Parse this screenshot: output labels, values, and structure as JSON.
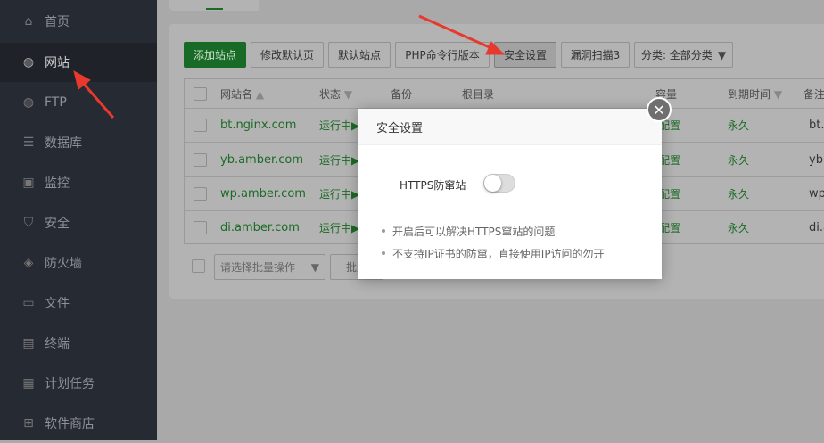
{
  "sidebar": {
    "items": [
      {
        "label": "首页",
        "icon": "home-icon"
      },
      {
        "label": "网站",
        "icon": "globe-icon",
        "active": true
      },
      {
        "label": "FTP",
        "icon": "ftp-icon"
      },
      {
        "label": "数据库",
        "icon": "database-icon"
      },
      {
        "label": "监控",
        "icon": "monitor-icon"
      },
      {
        "label": "安全",
        "icon": "shield-icon"
      },
      {
        "label": "防火墙",
        "icon": "firewall-icon"
      },
      {
        "label": "文件",
        "icon": "folder-icon"
      },
      {
        "label": "终端",
        "icon": "terminal-icon"
      },
      {
        "label": "计划任务",
        "icon": "calendar-icon"
      },
      {
        "label": "软件商店",
        "icon": "apps-icon"
      }
    ]
  },
  "toolbar": {
    "add_site": "添加站点",
    "edit_default_page": "修改默认页",
    "default_site": "默认站点",
    "php_cli": "PHP命令行版本",
    "security": "安全设置",
    "vuln_scan": "漏洞扫描3",
    "category": "分类: 全部分类"
  },
  "table": {
    "headers": {
      "name": "网站名",
      "status": "状态",
      "backup": "备份",
      "root": "根目录",
      "quota": "容量",
      "expire": "到期时间",
      "note": "备注"
    },
    "rows": [
      {
        "name": "bt.nginx.com",
        "status": "运行中",
        "quota": "未配置",
        "expire": "永久",
        "note": "bt.n"
      },
      {
        "name": "yb.amber.com",
        "status": "运行中",
        "quota": "未配置",
        "expire": "永久",
        "note": "yb.a"
      },
      {
        "name": "wp.amber.com",
        "status": "运行中",
        "quota": "未配置",
        "expire": "永久",
        "note": "wp.a"
      },
      {
        "name": "di.amber.com",
        "status": "运行中",
        "quota": "未配置",
        "expire": "永久",
        "note": "di.a"
      }
    ]
  },
  "footer": {
    "batch_placeholder": "请选择批量操作",
    "batch_button": "批量"
  },
  "modal": {
    "title": "安全设置",
    "toggle_label": "HTTPS防窜站",
    "toggle_on": false,
    "tips": [
      "开启后可以解决HTTPS窜站的问题",
      "不支持IP证书的防窜，直接使用IP访问的勿开"
    ]
  },
  "colors": {
    "accent": "#20a53a",
    "arrow": "#e8392f"
  }
}
